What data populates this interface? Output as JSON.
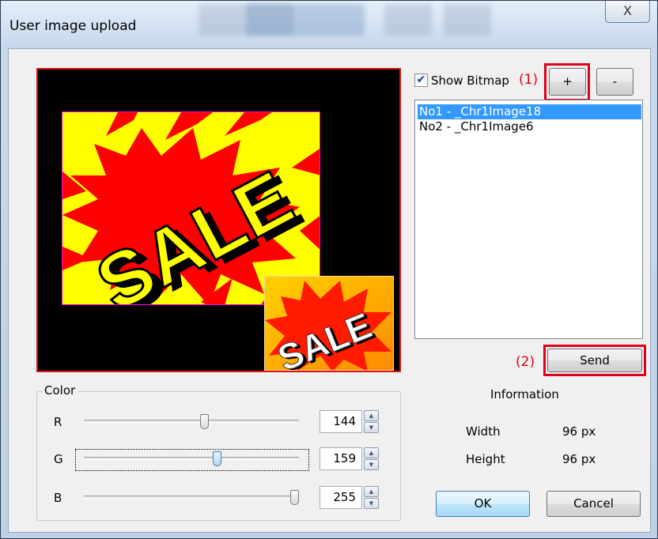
{
  "window": {
    "title": "User image upload",
    "close_glyph": "X"
  },
  "preview": {
    "main_image_text": "SALE",
    "thumbnail_text": "SALE"
  },
  "color": {
    "group_label": "Color",
    "rows": [
      {
        "label": "R",
        "value": "144",
        "level": 0.565
      },
      {
        "label": "G",
        "value": "159",
        "level": 0.624
      },
      {
        "label": "B",
        "value": "255",
        "level": 1.0
      }
    ]
  },
  "bitmap": {
    "show_label": "Show Bitmap",
    "show_checked": true,
    "add_label": "+",
    "remove_label": "-",
    "items": [
      "No1 - _Chr1Image18",
      "No2 - _Chr1Image6"
    ],
    "selected_index": 0
  },
  "annotations": {
    "a1": "(1)",
    "a2": "(2)",
    "color": "#e0001a"
  },
  "send_label": "Send",
  "info": {
    "heading": "Information",
    "width_label": "Width",
    "width_value": "96 px",
    "height_label": "Height",
    "height_value": "96 px"
  },
  "buttons": {
    "ok": "OK",
    "cancel": "Cancel"
  }
}
